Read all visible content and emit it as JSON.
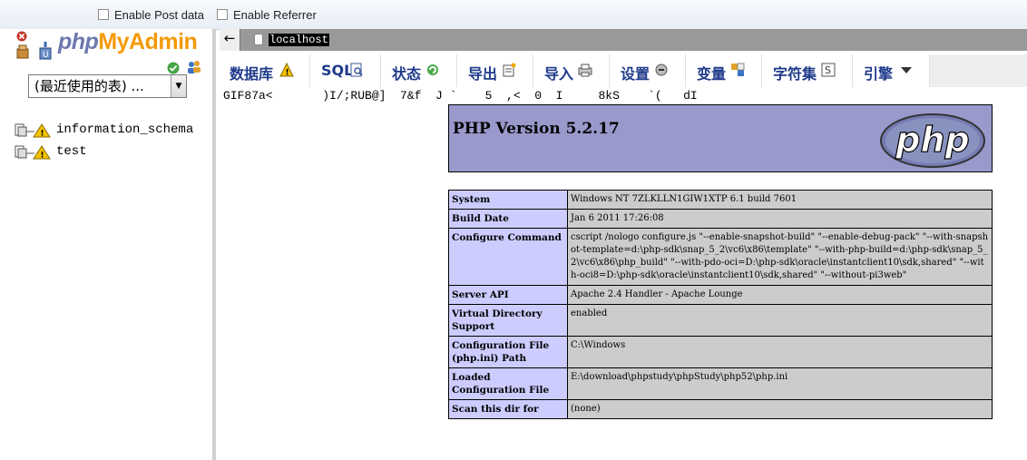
{
  "toolbar": {
    "post_data_label": "Enable Post data",
    "referrer_label": "Enable Referrer"
  },
  "nav": {
    "logo_php": "php",
    "logo_admin": "MyAdmin",
    "select_value": "(最近使用的表) ...",
    "databases": [
      "information_schema",
      "test"
    ]
  },
  "breadcrumb": {
    "back": "←",
    "server": "localhost"
  },
  "tabs": [
    {
      "label": "数据库",
      "icon": "warning-icon"
    },
    {
      "label": "SQL",
      "icon": "sql-icon"
    },
    {
      "label": "状态",
      "icon": "status-icon"
    },
    {
      "label": "导出",
      "icon": "export-icon"
    },
    {
      "label": "导入",
      "icon": "import-icon"
    },
    {
      "label": "设置",
      "icon": "settings-icon"
    },
    {
      "label": "变量",
      "icon": "variables-icon"
    },
    {
      "label": "字符集",
      "icon": "charset-icon"
    },
    {
      "label": "引擎",
      "icon": "dropdown-icon"
    }
  ],
  "garbage_text": "GIF87a<       )I/;RUB@]  7&f  J `    5  ,<  0  I     8kS    `(   dI",
  "phpinfo": {
    "title": "PHP Version 5.2.17",
    "logo_text": "php",
    "rows": [
      {
        "k": "System",
        "v": "Windows NT 7ZLKLLN1GIW1XTP 6.1 build 7601"
      },
      {
        "k": "Build Date",
        "v": "Jan 6 2011 17:26:08"
      },
      {
        "k": "Configure Command",
        "v": "cscript /nologo configure.js \"--enable-snapshot-build\" \"--enable-debug-pack\" \"--with-snapshot-template=d:\\php-sdk\\snap_5_2\\vc6\\x86\\template\" \"--with-php-build=d:\\php-sdk\\snap_5_2\\vc6\\x86\\php_build\" \"--with-pdo-oci=D:\\php-sdk\\oracle\\instantclient10\\sdk,shared\" \"--with-oci8=D:\\php-sdk\\oracle\\instantclient10\\sdk,shared\" \"--without-pi3web\""
      },
      {
        "k": "Server API",
        "v": "Apache 2.4 Handler - Apache Lounge"
      },
      {
        "k": "Virtual Directory Support",
        "v": "enabled"
      },
      {
        "k": "Configuration File (php.ini) Path",
        "v": "C:\\Windows"
      },
      {
        "k": "Loaded Configuration File",
        "v": "E:\\download\\phpstudy\\phpStudy\\php52\\php.ini"
      },
      {
        "k": "Scan this dir for",
        "v": "(none)"
      }
    ]
  }
}
